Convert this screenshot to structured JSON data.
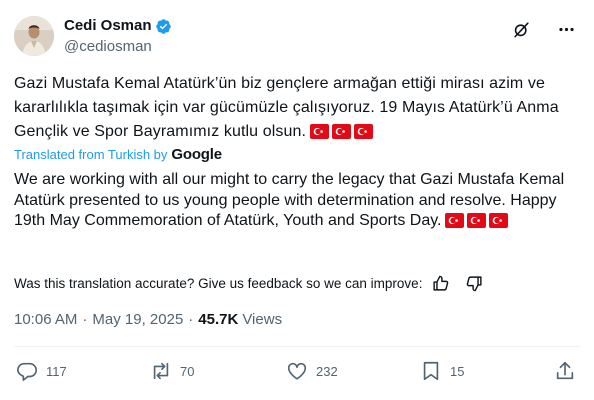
{
  "author": {
    "display_name": "Cedi Osman",
    "handle": "@cediosman",
    "verified": true
  },
  "tweet": {
    "text": "Gazi Mustafa Kemal Atatürk’ün biz gençlere armağan ettiği mirası azim ve kararlılıkla taşımak için var gücümüzle çalışıyoruz. 19 Mayıs Atatürk’ü Anma Gençlik ve Spor Bayramımız kutlu olsun.",
    "flag_emoji_count": 3
  },
  "translation": {
    "label": "Translated from Turkish by",
    "provider": "Google",
    "text": "We are working with all our might to carry the legacy that Gazi Mustafa Kemal Atatürk presented to us young people with determination and resolve. Happy 19th May Commemoration of Atatürk, Youth and Sports Day.",
    "feedback_prompt": "Was this translation accurate? Give us feedback so we can improve:"
  },
  "meta": {
    "time": "10:06 AM",
    "separator": "·",
    "date": "May 19, 2025",
    "separator2": "·",
    "views_count": "45.7K",
    "views_label": "Views"
  },
  "actions": {
    "replies": "117",
    "reposts": "70",
    "likes": "232",
    "bookmarks": "15"
  },
  "colors": {
    "accent": "#1d9bf0",
    "text": "#0f1419",
    "secondary": "#536471",
    "flag_red": "#e30a17"
  },
  "icons": [
    "verified-badge-icon",
    "grok-icon",
    "more-icon",
    "thumbs-up-icon",
    "thumbs-down-icon",
    "reply-icon",
    "repost-icon",
    "like-icon",
    "bookmark-icon",
    "share-icon"
  ]
}
